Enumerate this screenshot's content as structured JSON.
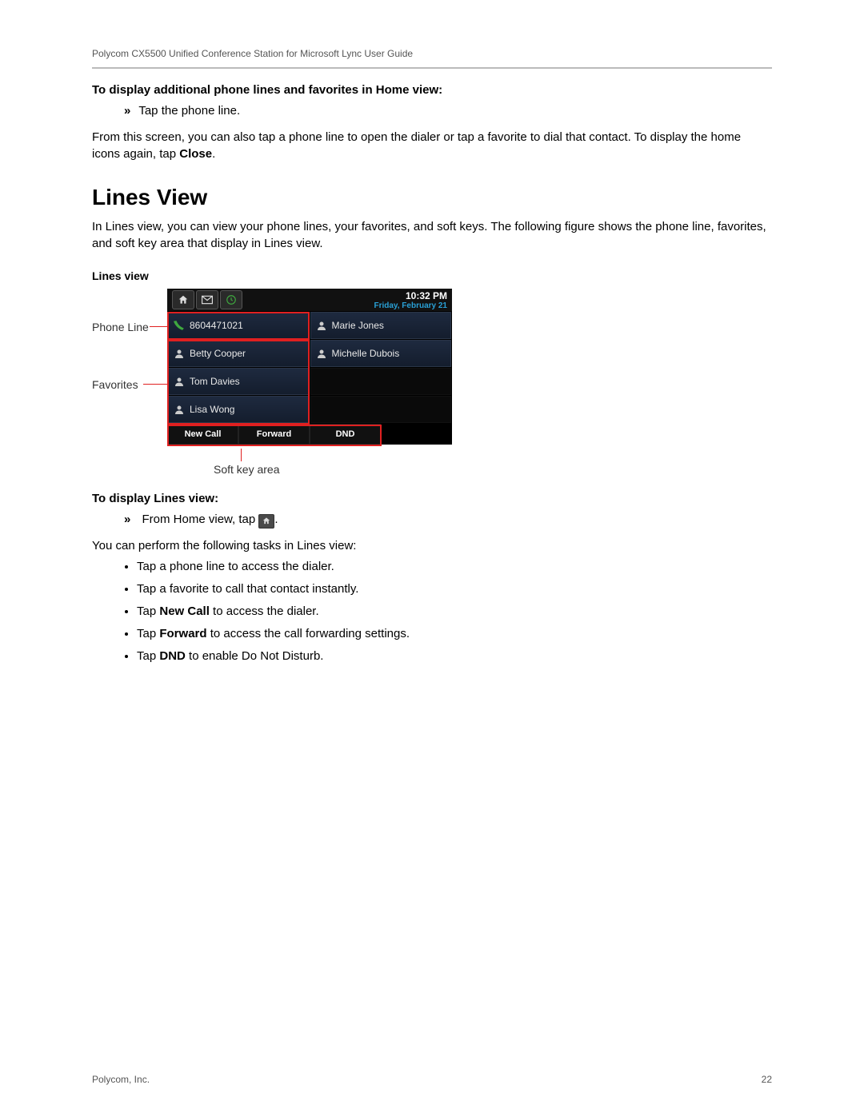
{
  "header": "Polycom CX5500 Unified Conference Station for Microsoft Lync User Guide",
  "instr1_heading": "To display additional phone lines and favorites in Home view:",
  "instr1_item": "Tap the phone line.",
  "para1a": "From this screen, you can also tap a phone line to open the dialer or tap a favorite to dial that contact. To display the home icons again, tap ",
  "para1_bold": "Close",
  "para1b": ".",
  "section_title": "Lines View",
  "para2": "In Lines view, you can view your phone lines, your favorites, and soft keys. The following figure shows the phone line, favorites, and soft key area that display in Lines view.",
  "fig_caption": "Lines view",
  "labels": {
    "phone_line": "Phone Line",
    "favorites": "Favorites",
    "softkey": "Soft key area"
  },
  "phone": {
    "time": "10:32 PM",
    "date": "Friday, February 21",
    "line_number": "8604471021",
    "favorites": [
      "Betty Cooper",
      "Tom Davies",
      "Lisa Wong",
      "Marie Jones",
      "Michelle Dubois"
    ],
    "softkeys": [
      "New Call",
      "Forward",
      "DND"
    ]
  },
  "instr2_heading": "To display Lines view:",
  "instr2_prefix": "From Home view, tap ",
  "instr2_suffix": ".",
  "para3": "You can perform the following tasks in Lines view:",
  "tasks": [
    {
      "pre": "Tap a phone line to access the dialer.",
      "bold": "",
      "post": ""
    },
    {
      "pre": "Tap a favorite to call that contact instantly.",
      "bold": "",
      "post": ""
    },
    {
      "pre": "Tap ",
      "bold": "New Call",
      "post": " to access the dialer."
    },
    {
      "pre": "Tap ",
      "bold": "Forward",
      "post": " to access the call forwarding settings."
    },
    {
      "pre": "Tap ",
      "bold": "DND",
      "post": " to enable Do Not Disturb."
    }
  ],
  "footer_left": "Polycom, Inc.",
  "footer_right": "22"
}
